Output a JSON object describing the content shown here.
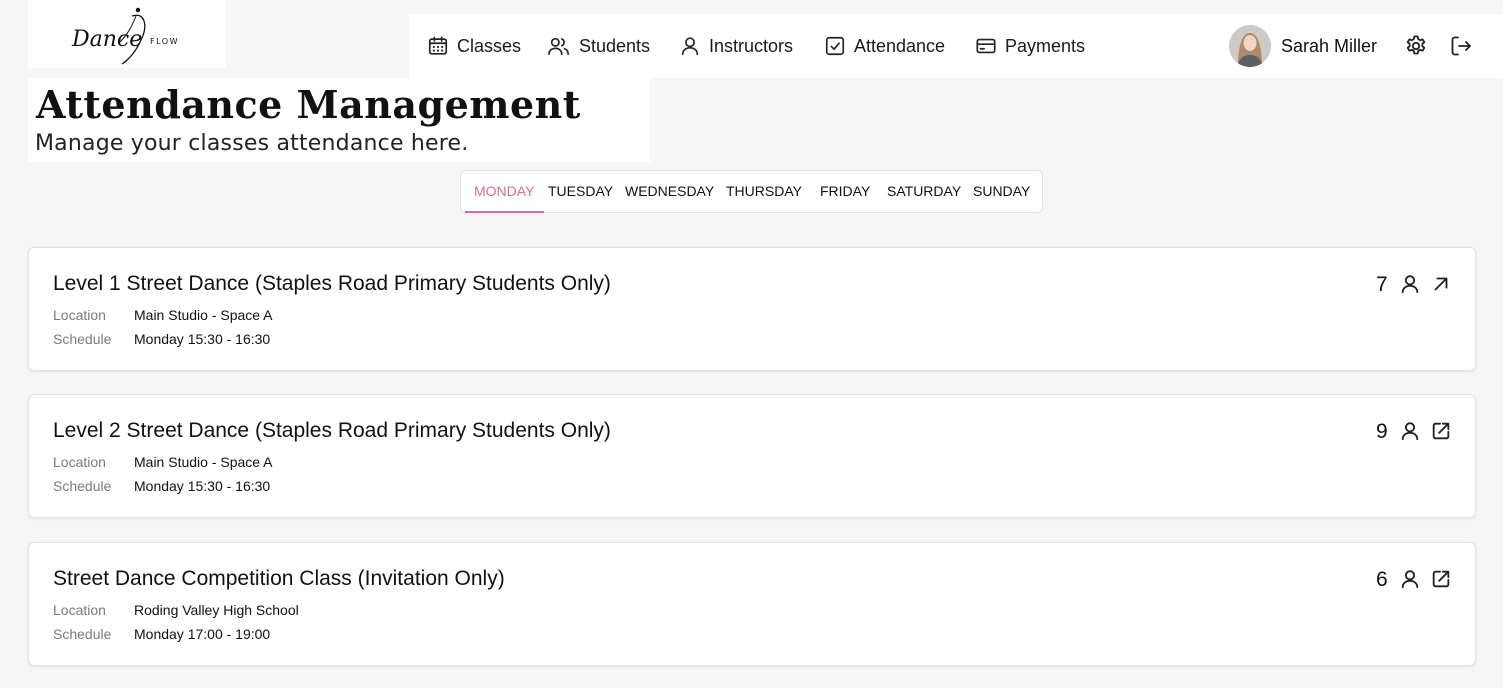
{
  "logo": {
    "text_main": "Dance",
    "text_side": "FLOW"
  },
  "nav": {
    "items": [
      {
        "label": "Classes",
        "icon": "calendar-icon"
      },
      {
        "label": "Students",
        "icon": "users-icon"
      },
      {
        "label": "Instructors",
        "icon": "user-icon"
      },
      {
        "label": "Attendance",
        "icon": "check-square-icon"
      },
      {
        "label": "Payments",
        "icon": "credit-card-icon"
      }
    ],
    "user_name": "Sarah Miller"
  },
  "page": {
    "title": "Attendance Management",
    "subtitle": "Manage your classes attendance here."
  },
  "tabs": {
    "days": [
      "MONDAY",
      "TUESDAY",
      "WEDNESDAY",
      "THURSDAY",
      "FRIDAY",
      "SATURDAY",
      "SUNDAY"
    ],
    "active": "MONDAY"
  },
  "labels": {
    "location": "Location",
    "schedule": "Schedule"
  },
  "colors": {
    "accent": "#d0709a",
    "background": "#f6f6f6"
  },
  "classes": [
    {
      "name": "Level 1 Street Dance (Staples Road Primary Students Only)",
      "location": "Main Studio - Space A",
      "schedule": "Monday 15:30 - 16:30",
      "count": "7",
      "action_icon": "arrow-up-right-icon"
    },
    {
      "name": "Level 2 Street Dance (Staples Road Primary Students Only)",
      "location": "Main Studio - Space A",
      "schedule": "Monday 15:30 - 16:30",
      "count": "9",
      "action_icon": "external-link-icon"
    },
    {
      "name": "Street Dance Competition Class (Invitation Only)",
      "location": "Roding Valley High School",
      "schedule": "Monday 17:00 - 19:00",
      "count": "6",
      "action_icon": "external-link-icon"
    }
  ]
}
